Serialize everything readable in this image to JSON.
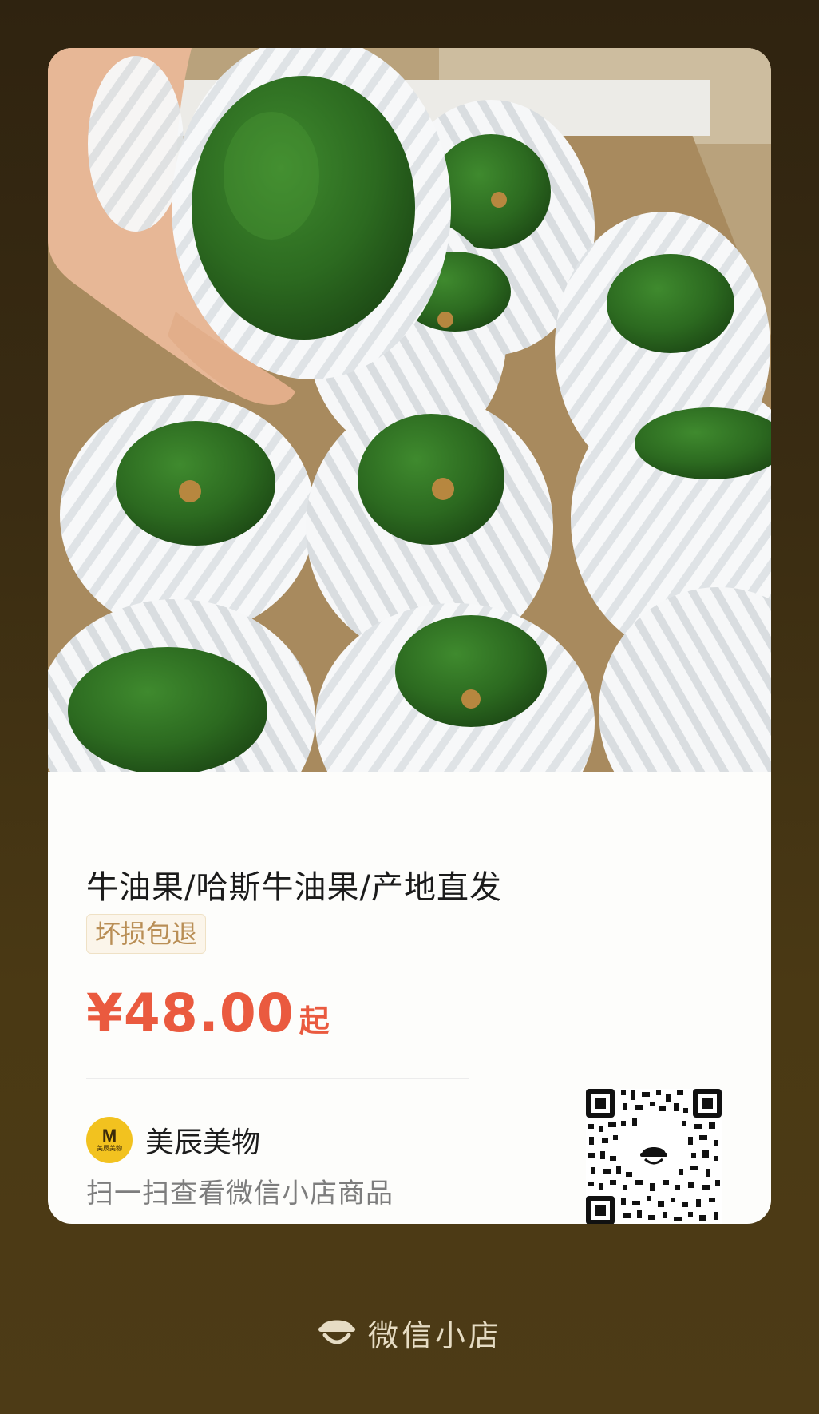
{
  "product": {
    "title": "牛油果/哈斯牛油果/产地直发",
    "tag": "坏损包退",
    "price": "¥48.00",
    "price_suffix": "起"
  },
  "shop": {
    "name": "美辰美物",
    "logo_letter": "M",
    "logo_subtext": "美辰美物",
    "scan_hint": "扫一扫查看微信小店商品"
  },
  "footer": {
    "brand_label": "微信小店"
  },
  "colors": {
    "price": "#ea5a3f",
    "tag_text": "#b98e55",
    "background": "#3a2c12",
    "logo": "#f2c21f"
  },
  "icons": {
    "qr": "qr-code-icon",
    "brand": "wechat-shop-icon"
  }
}
